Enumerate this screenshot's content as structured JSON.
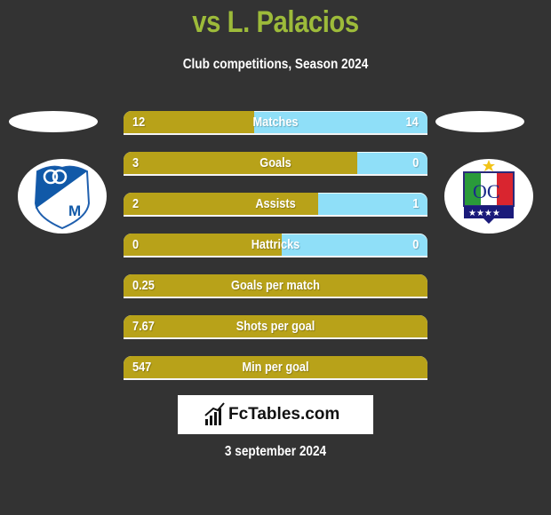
{
  "header": {
    "title": "vs L. Palacios",
    "subtitle": "Club competitions, Season 2024"
  },
  "teams": {
    "left": {
      "logo": "millonarios-crest-icon"
    },
    "right": {
      "logo": "once-caldas-crest-icon"
    }
  },
  "colors": {
    "left_bar": "#b8a219",
    "right_bar": "#8fdff8",
    "title": "#9dbb3a",
    "background": "#333333"
  },
  "stats": [
    {
      "label": "Matches",
      "left": "12",
      "right": "14",
      "left_share": 0.43
    },
    {
      "label": "Goals",
      "left": "3",
      "right": "0",
      "left_share": 0.77
    },
    {
      "label": "Assists",
      "left": "2",
      "right": "1",
      "left_share": 0.64
    },
    {
      "label": "Hattricks",
      "left": "0",
      "right": "0",
      "left_share": 0.52
    },
    {
      "label": "Goals per match",
      "left": "0.25",
      "right": "",
      "left_share": 1
    },
    {
      "label": "Shots per goal",
      "left": "7.67",
      "right": "",
      "left_share": 1
    },
    {
      "label": "Min per goal",
      "left": "547",
      "right": "",
      "left_share": 1
    }
  ],
  "brand": {
    "name": "FcTables.com",
    "icon": "bar-chart-icon"
  },
  "footer": {
    "date": "3 september 2024"
  }
}
